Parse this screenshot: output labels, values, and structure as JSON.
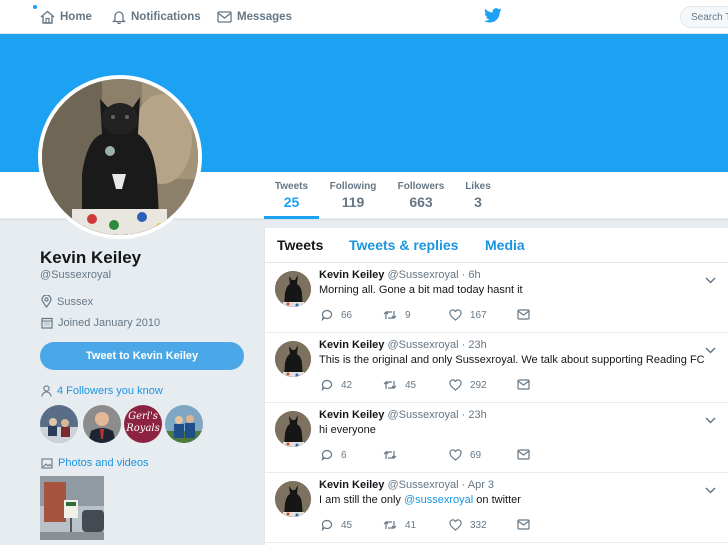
{
  "nav": {
    "home_label": "Home",
    "notifications_label": "Notifications",
    "messages_label": "Messages",
    "search_placeholder": "Search Tw"
  },
  "stats": [
    {
      "label": "Tweets",
      "value": "25"
    },
    {
      "label": "Following",
      "value": "119"
    },
    {
      "label": "Followers",
      "value": "663"
    },
    {
      "label": "Likes",
      "value": "3"
    }
  ],
  "profile": {
    "name": "Kevin Keiley",
    "handle": "@Sussexroyal",
    "location": "Sussex",
    "joined": "Joined January 2010",
    "tweet_to_label": "Tweet to Kevin Keiley",
    "followers_you_know": "4 Followers you know",
    "photos_label": "Photos and videos",
    "follower3_text": "Gerl's Royals"
  },
  "tabs": [
    {
      "label": "Tweets"
    },
    {
      "label": "Tweets & replies"
    },
    {
      "label": "Media"
    }
  ],
  "tweets": [
    {
      "name": "Kevin Keiley",
      "meta": "@Sussexroyal · 6h",
      "text": "Morning all. Gone a bit mad today hasnt it",
      "mention": "",
      "text_after": "",
      "replies": "66",
      "retweets": "9",
      "likes": "167"
    },
    {
      "name": "Kevin Keiley",
      "meta": "@Sussexroyal · 23h",
      "text": "This is the original and only Sussexroyal. We talk about supporting Reading FC",
      "mention": "",
      "text_after": "",
      "replies": "42",
      "retweets": "45",
      "likes": "292"
    },
    {
      "name": "Kevin Keiley",
      "meta": "@Sussexroyal · 23h",
      "text": "hi everyone",
      "mention": "",
      "text_after": "",
      "replies": "6",
      "retweets": "",
      "likes": "69"
    },
    {
      "name": "Kevin Keiley",
      "meta": "@Sussexroyal · Apr 3",
      "text": "I am still the only ",
      "mention": "@sussexroyal",
      "text_after": " on twitter",
      "replies": "45",
      "retweets": "41",
      "likes": "332"
    }
  ],
  "colors": {
    "brand_blue": "#1da1f2",
    "link_blue": "#1b95e0",
    "tweet_to_button": "#4aa8e8",
    "page_bg": "#e6ecf0"
  }
}
